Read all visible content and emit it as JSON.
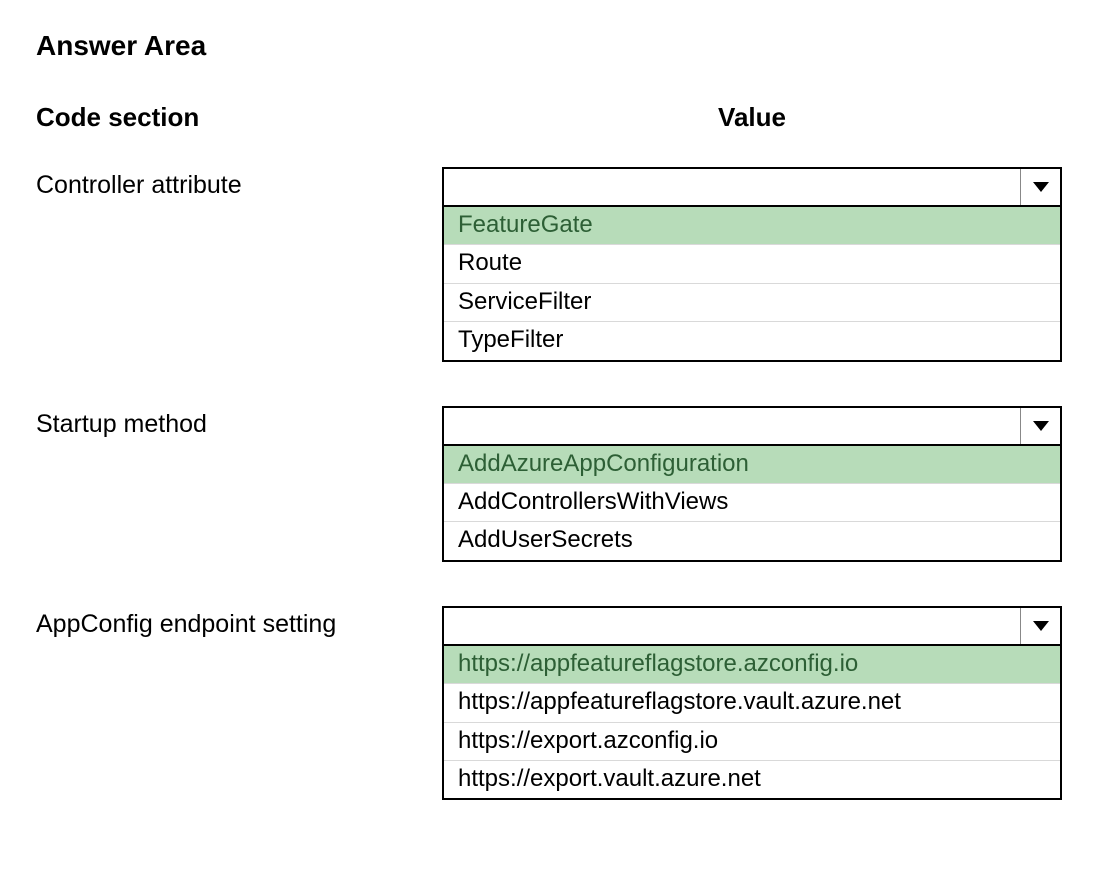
{
  "title": "Answer Area",
  "headers": {
    "left": "Code section",
    "right": "Value"
  },
  "sections": [
    {
      "label": "Controller attribute",
      "options": [
        {
          "text": "FeatureGate",
          "selected": true
        },
        {
          "text": "Route",
          "selected": false
        },
        {
          "text": "ServiceFilter",
          "selected": false
        },
        {
          "text": "TypeFilter",
          "selected": false
        }
      ]
    },
    {
      "label": "Startup method",
      "options": [
        {
          "text": "AddAzureAppConfiguration",
          "selected": true
        },
        {
          "text": "AddControllersWithViews",
          "selected": false
        },
        {
          "text": "AddUserSecrets",
          "selected": false
        }
      ]
    },
    {
      "label": "AppConfig endpoint setting",
      "options": [
        {
          "text": "https://appfeatureflagstore.azconfig.io",
          "selected": true
        },
        {
          "text": "https://appfeatureflagstore.vault.azure.net",
          "selected": false
        },
        {
          "text": "https://export.azconfig.io",
          "selected": false
        },
        {
          "text": "https://export.vault.azure.net",
          "selected": false
        }
      ]
    }
  ]
}
